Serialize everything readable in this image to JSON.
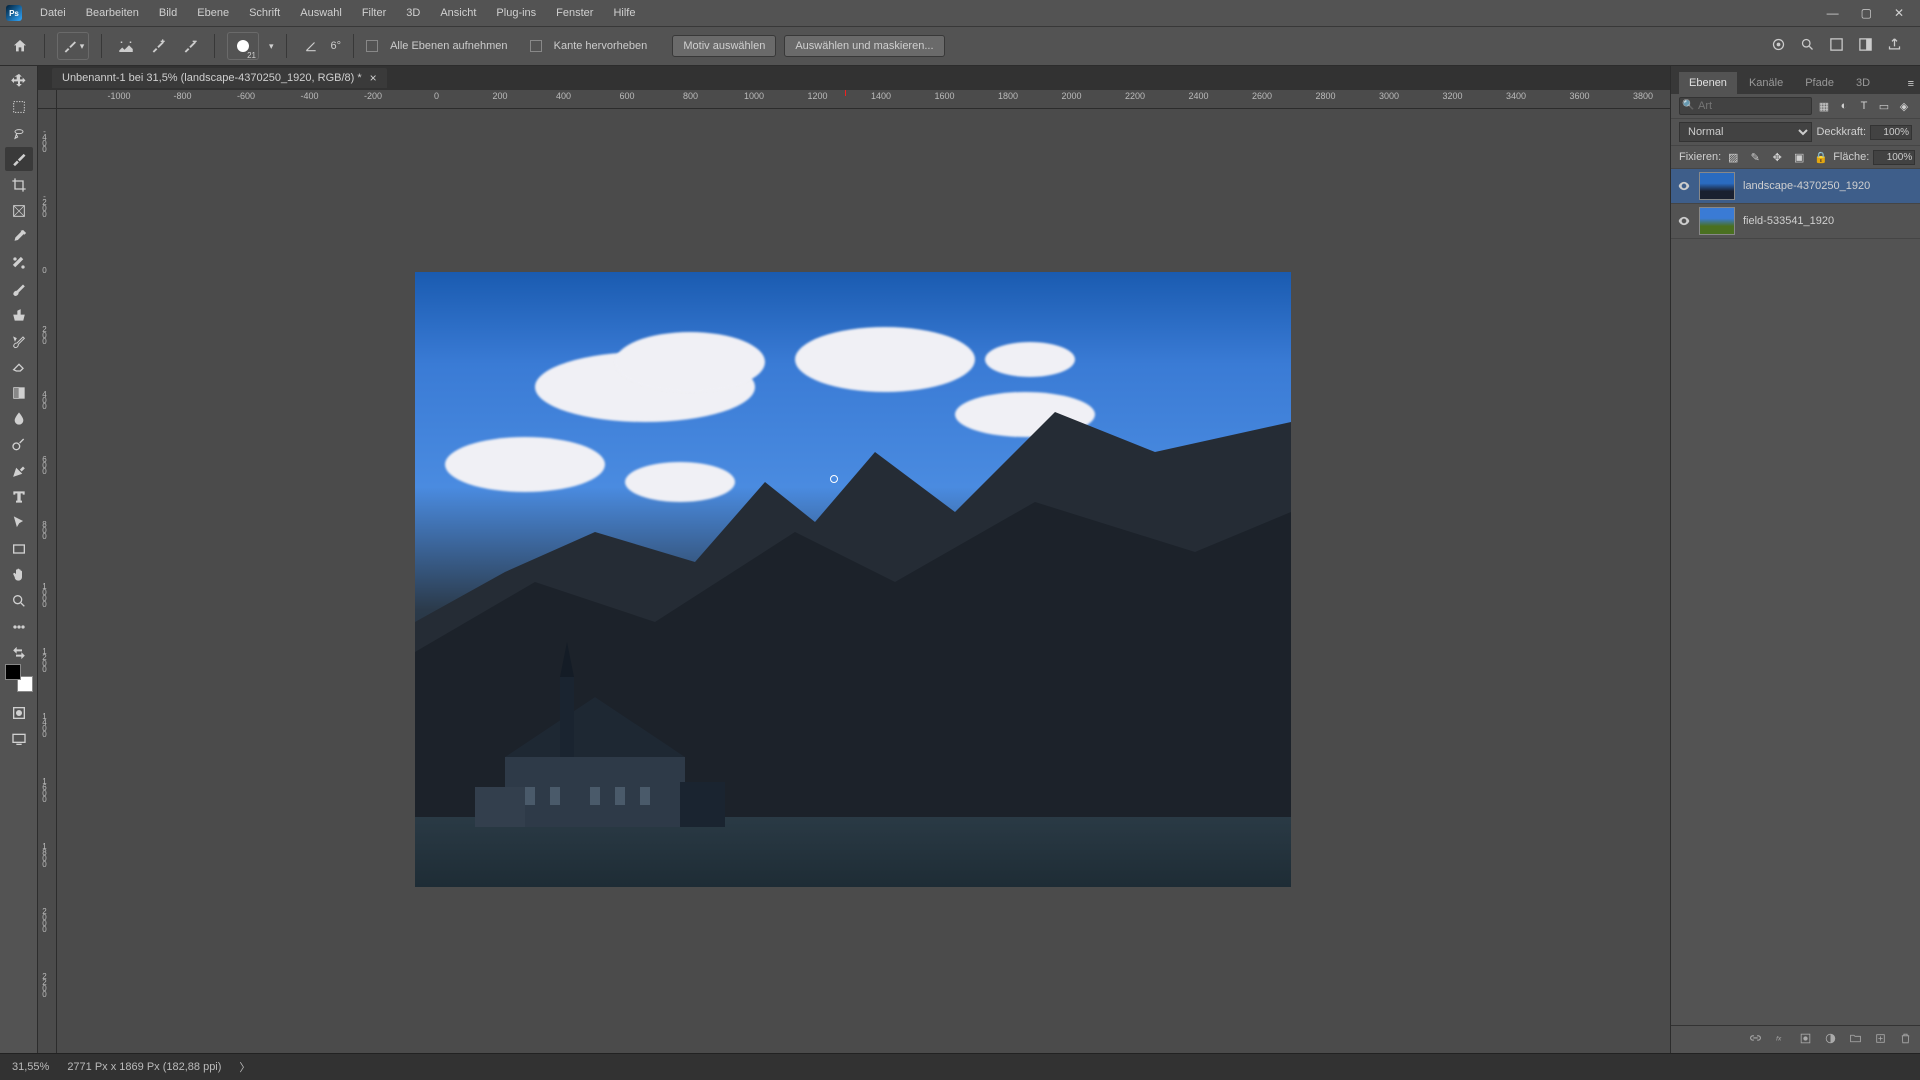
{
  "menu": {
    "items": [
      "Datei",
      "Bearbeiten",
      "Bild",
      "Ebene",
      "Schrift",
      "Auswahl",
      "Filter",
      "3D",
      "Ansicht",
      "Plug-ins",
      "Fenster",
      "Hilfe"
    ]
  },
  "window_controls": {
    "min": "—",
    "max": "▢",
    "close": "✕"
  },
  "options": {
    "brush_size": "21",
    "angle": "6°",
    "chk1_label": "Alle Ebenen aufnehmen",
    "chk2_label": "Kante hervorheben",
    "btn_subject": "Motiv auswählen",
    "btn_selectmask": "Auswählen und maskieren..."
  },
  "doc_tab": {
    "title": "Unbenannt-1 bei 31,5% (landscape-4370250_1920, RGB/8) *",
    "close": "×"
  },
  "ruler_h": [
    "-1000",
    "-800",
    "-600",
    "-400",
    "-200",
    "0",
    "200",
    "400",
    "600",
    "800",
    "1000",
    "1200",
    "1400",
    "1600",
    "1800",
    "2000",
    "2200",
    "2400",
    "2600",
    "2800",
    "3000",
    "3200",
    "3400",
    "3600",
    "3800"
  ],
  "ruler_v": [
    "-400",
    "-200",
    "0",
    "200",
    "400",
    "600",
    "800",
    "1000",
    "1200",
    "1400",
    "1600",
    "1800",
    "2000",
    "2200"
  ],
  "panel": {
    "tabs": [
      "Ebenen",
      "Kanäle",
      "Pfade",
      "3D"
    ],
    "search_placeholder": "Art",
    "blend_mode": "Normal",
    "opacity_label": "Deckkraft:",
    "opacity_value": "100%",
    "lock_label": "Fixieren:",
    "fill_label": "Fläche:",
    "fill_value": "100%",
    "layers": [
      {
        "name": "landscape-4370250_1920"
      },
      {
        "name": "field-533541_1920"
      }
    ]
  },
  "status": {
    "zoom": "31,55%",
    "doc_size": "2771 Px x 1869 Px (182,88 ppi)",
    "chev": "〉"
  },
  "icons": {
    "home": "home",
    "search": "search",
    "brush": "brush"
  }
}
